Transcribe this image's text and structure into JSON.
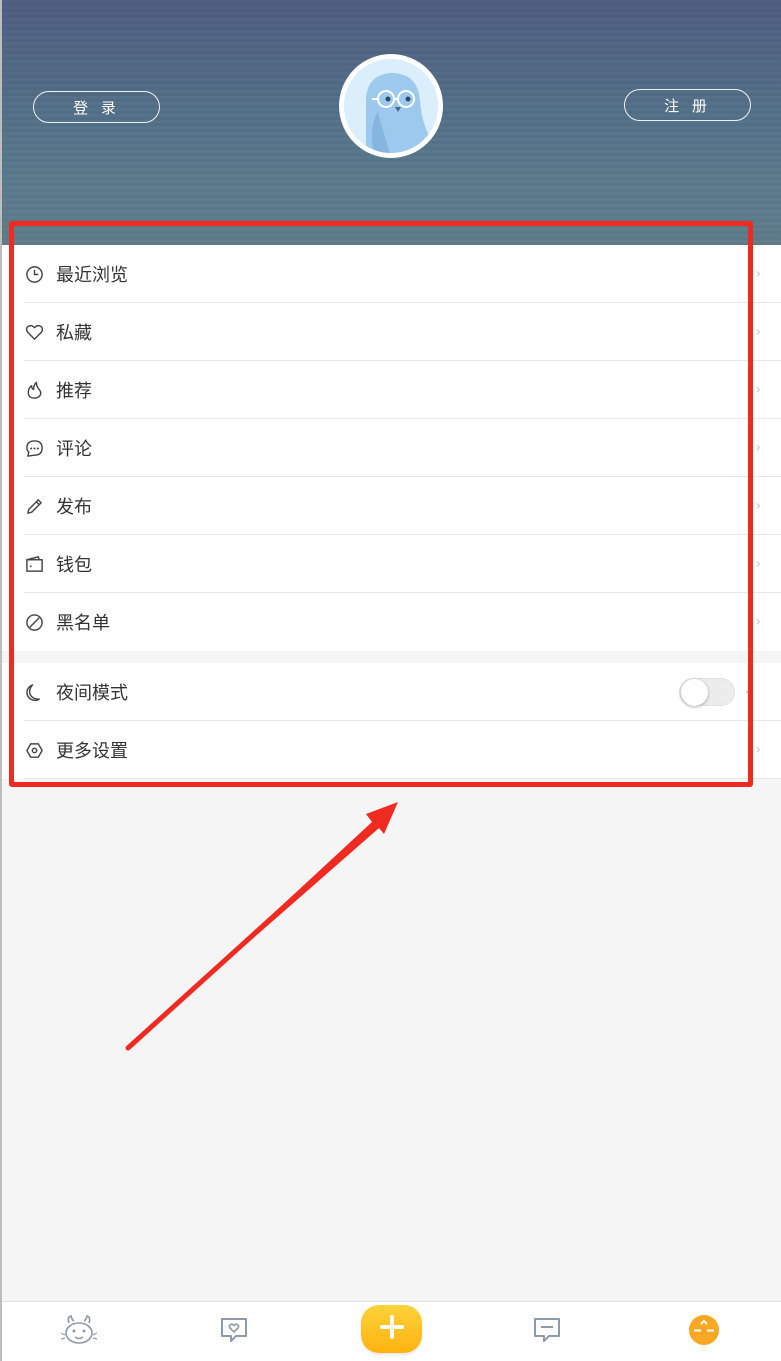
{
  "header": {
    "login_label": "登 录",
    "register_label": "注 册",
    "avatar_icon": "bird-avatar-icon"
  },
  "menu": {
    "items": [
      {
        "label": "最近浏览",
        "icon": "clock-icon"
      },
      {
        "label": "私藏",
        "icon": "heart-icon"
      },
      {
        "label": "推荐",
        "icon": "flame-icon"
      },
      {
        "label": "评论",
        "icon": "comment-icon"
      },
      {
        "label": "发布",
        "icon": "pencil-icon"
      },
      {
        "label": "钱包",
        "icon": "wallet-icon"
      },
      {
        "label": "黑名单",
        "icon": "block-icon"
      }
    ],
    "night_mode": {
      "label": "夜间模式",
      "icon": "moon-icon",
      "enabled": false
    },
    "more_settings": {
      "label": "更多设置",
      "icon": "hexagon-settings-icon"
    }
  },
  "tabbar": {
    "tabs": [
      {
        "icon": "dragon-home-icon"
      },
      {
        "icon": "heart-bubble-icon"
      },
      {
        "icon": "plus-icon"
      },
      {
        "icon": "message-icon"
      },
      {
        "icon": "profile-face-icon"
      }
    ]
  },
  "colors": {
    "accent": "#ffb30f",
    "annotation": "#ef2a20",
    "header_top": "#4f5d80",
    "header_bottom": "#5f7b89"
  }
}
